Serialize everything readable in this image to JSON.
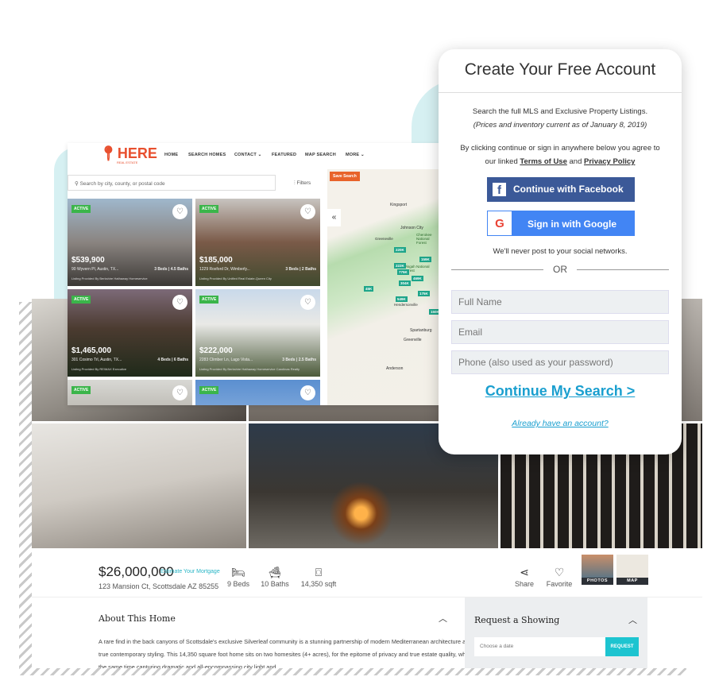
{
  "site": {
    "logo": "HERE",
    "logo_sub": "REAL ESTATE",
    "nav": [
      "HOME",
      "SEARCH HOMES",
      "CONTACT ⌄",
      "FEATURED",
      "MAP SEARCH",
      "MORE ⌄"
    ],
    "search_placeholder": "Search by city, county, or postal code",
    "filters": "Filters",
    "save_search": "Save Search",
    "listings": [
      {
        "status": "ACTIVE",
        "price": "$539,900",
        "address": "90 Wyvern Pl, Austin, TX...",
        "beds_baths": "3 Beds | 4.5 Baths",
        "provider": "Listing Provided By Berkshire Hathaway Homeservice"
      },
      {
        "status": "ACTIVE",
        "price": "$185,000",
        "address": "1229 Roxford Dr, Wimberly...",
        "beds_baths": "3 Beds | 2 Baths",
        "provider": "Listing Provided By Unified Real Estate-Queen City"
      },
      {
        "status": "ACTIVE",
        "price": "$1,465,000",
        "address": "301 Cosimo Trl, Austin, TX...",
        "beds_baths": "4 Beds | 6 Baths",
        "provider": "Listing Provided By RE/MAX Executive"
      },
      {
        "status": "ACTIVE",
        "price": "$222,000",
        "address": "2283 Climber Ln, Lago Vista...",
        "beds_baths": "3 Beds | 2.5 Baths",
        "provider": "Listing Provided By Berkshire Hathaway Homeservice Carolinas Realty"
      },
      {
        "status": "ACTIVE"
      },
      {
        "status": "ACTIVE"
      }
    ],
    "map_labels": [
      "Kingsport",
      "Johnson City",
      "Greeneville",
      "Cherokee National Forest",
      "Pisgah National Forest",
      "Hendersonville",
      "Greenville",
      "Spartanburg",
      "Anderson"
    ],
    "map_pins": [
      "220K",
      "159K",
      "222K",
      "775K",
      "469K",
      "304K",
      "45K",
      "549K",
      "175K",
      "150K"
    ]
  },
  "property": {
    "price": "$26,000,000",
    "mortgage_link": "Estimate Your Mortgage",
    "address": "123 Mansion Ct, Scottsdale AZ  85255",
    "stats": [
      {
        "icon": "bed-icon",
        "label": "9 Beds"
      },
      {
        "icon": "bath-icon",
        "label": "10 Baths"
      },
      {
        "icon": "area-icon",
        "label": "14,350 sqft"
      }
    ],
    "share": "Share",
    "favorite": "Favorite",
    "photos": "PHOTOS",
    "map": "MAP",
    "about_title": "About This Home",
    "about_text": "A rare find in the back canyons of Scottsdale's exclusive Silverleaf community is a stunning partnership of modern Mediterranean architecture and true contemporary styling. This 14,350 square foot home sits on two homesites (4+ acres), for the epitome of privacy and true estate quality, while at the same time capturing dramatic and all-encompassing city light and",
    "request_title": "Request a Showing",
    "date_placeholder": "Choose a date",
    "request_button": "REQUEST"
  },
  "modal": {
    "title": "Create Your Free Account",
    "line1": "Search the full MLS and Exclusive Property Listings.",
    "line2": "(Prices and inventory current as of January 8, 2019)",
    "agree1": "By clicking continue or sign in anywhere below you agree to",
    "agree2a": "our linked ",
    "terms": "Terms of Use",
    "and": " and ",
    "privacy": "Privacy Policy",
    "facebook": "Continue with Facebook",
    "google": "Sign in with Google",
    "never_post": "We'll never post to your social networks.",
    "or": "OR",
    "name_ph": "Full Name",
    "email_ph": "Email",
    "phone_ph": "Phone (also used as your password)",
    "continue": "Continue My Search >",
    "already": "Already have an account?"
  },
  "colors": {
    "accent": "#1dc4d0",
    "facebook": "#3b5998",
    "google": "#4285f4",
    "active_badge": "#3bb54a",
    "logo": "#e8502f"
  }
}
